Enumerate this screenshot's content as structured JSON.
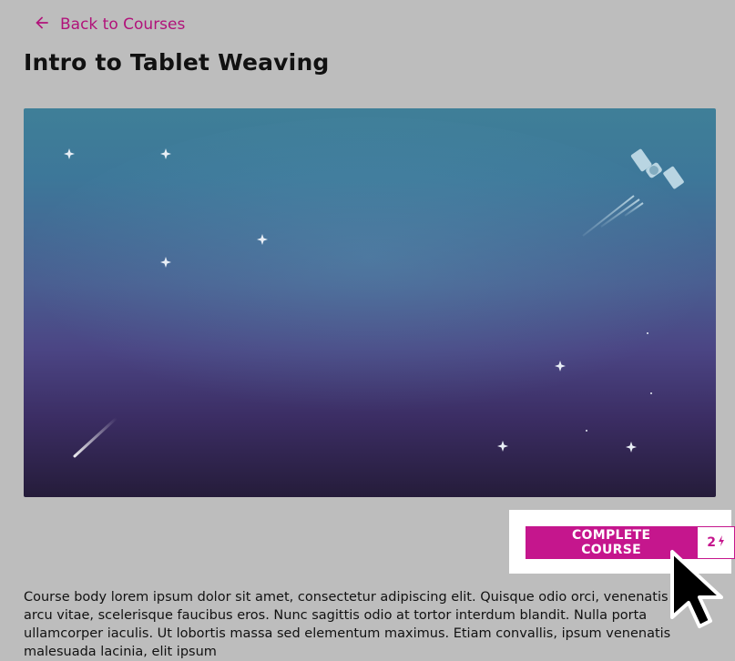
{
  "nav": {
    "back_label": "Back to Courses"
  },
  "course": {
    "title": "Intro to Tablet Weaving",
    "body": "Course body lorem ipsum dolor sit amet, consectetur adipiscing elit. Quisque odio orci, venenatis in arcu vitae, scelerisque faucibus eros. Nunc sagittis odio at tortor interdum blandit. Nulla porta ullamcorper iaculis. Ut lobortis massa sed elementum maximus. Etiam convallis, ipsum venenatis malesuada lacinia, elit ipsum"
  },
  "cta": {
    "button_label": "COMPLETE COURSE",
    "points": "2"
  },
  "colors": {
    "accent": "#c5168d",
    "link": "#b1127a",
    "page_bg": "#bdbdbd"
  },
  "icons": {
    "back": "arrow-left-icon",
    "points": "lightning-icon",
    "hero": "satellite-icon"
  }
}
